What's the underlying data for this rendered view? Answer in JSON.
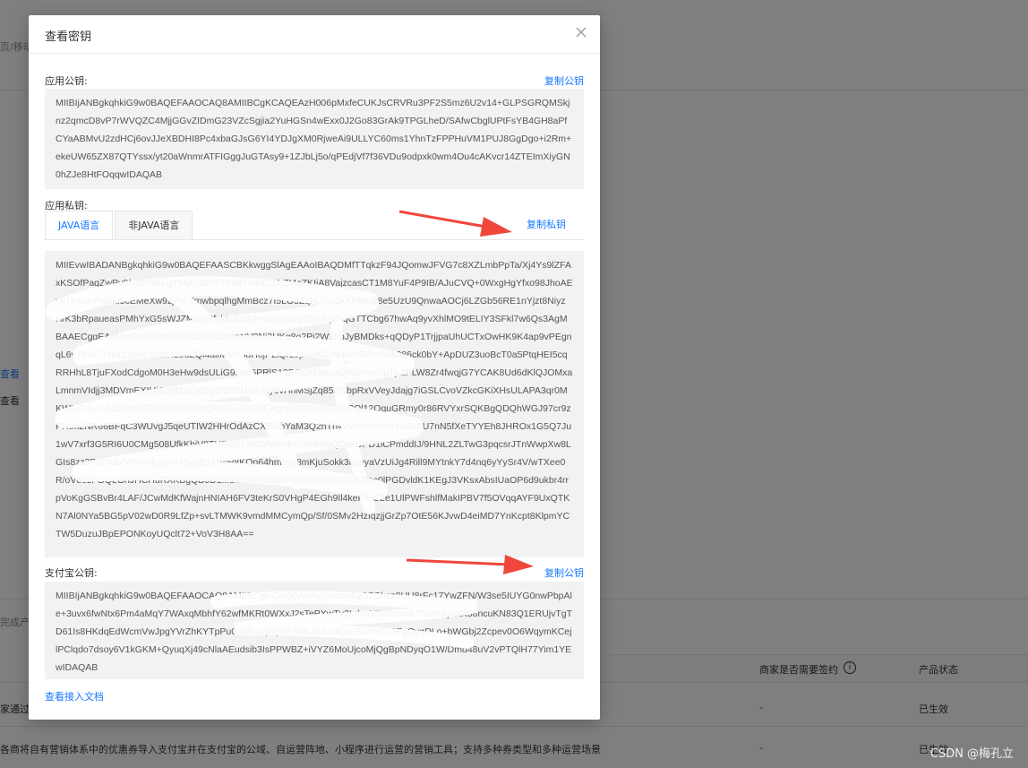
{
  "background": {
    "left_fragments": [
      "页/移动",
      "查看",
      "查看",
      "完成产",
      "家通过"
    ],
    "bottom_row_text": "各商将自有营销体系中的优惠券导入支付宝并在支付宝的公域、自运营阵地、小程序进行运营的营销工具；支持多种券类型和多种运营场景",
    "table_headers": {
      "signing": "商家是否需要签约",
      "status": "产品状态"
    },
    "row1": {
      "signing": "-",
      "status": "已生效"
    },
    "row2": {
      "signing": "-",
      "status": "已生效"
    }
  },
  "modal": {
    "title": "查看密钥",
    "app_public_key": {
      "label": "应用公钥:",
      "copy_label": "复制公钥",
      "value": "MIIBIjANBgkqhkiG9w0BAQEFAAOCAQ8AMIIBCgKCAQEAzH006pMxfeCUKJsCRVRu3PF2S5mz6U2v14+GLPSGRQMSkjnz2qmcD8vP7rWVQZC4MjjGGvZIDmG23VZcSgjia2YuHGSn4wExx0J2Go83GrAk9TPGLheD/SAfwCbglUPtFsYB4GH8aPfCYaABMvU2zdHCj6ovJJeXBDHI8Pc4xbaGJsG6YI4YDJgXM0RjweAi9ULLYC60ms1YhnTzFPPHuVM1PUJ8GgDgo+i2Rm+ekeUW65ZX87QTYssx/yt20aWnmrATFIGggJuGTAsy9+1ZJbLj5o/qPEdjVf7f36VDu9odpxk0wm4Ou4cAKvcr14ZTEImXiyGN0hZJe8HtFOqqwIDAQAB"
    },
    "app_private_key": {
      "label": "应用私钥:",
      "copy_label": "复制私钥",
      "tabs": [
        "JAVA语言",
        "非JAVA语言"
      ],
      "active_tab": 0,
      "value": "MIIEvwIBADANBgkqhkiG9w0BAQEFAASCBKkwggSlAgEAAoIBAQDMfTTqkzF94JQomwJFVG7c8XZLmbPpTa/Xj4Ys9lZFAxKSOfPaqZwPy8/utZVBkLgYMjiEoDcRTbbdVIxKCOJrZI4cZKIjA8VajzcasCT1M8YuF4P9IB/AJuCVQ+0WxgHgYfxo98JhoAEy9TK6cKPqi8kI5cEMeXw9zjFtoYmwbpqlhgMmBcz7I5LG5ZqhLrSa2xXPMU88e5UzU9QnwaAOCj6LZGb56RE1nYjzt8NiyzH/K3bRpaueasPMhYxG5sWJZMaQRfvkIcZaMJ+o8R2N1Q7fpUCj2hqGTTCbg67hwAq9yvXhlMO9tELIY3SFkl7w6Qs3AgMBAAECggEAaHrq5Hybt8pdK3BjJzqbf1azwsNV8Nj2HKq8o2Pi2W1hpJyBMDks+qQDyP1TrjjpaUhUCTxOwHK9K4ap9vPEgnqL6vTIOs7J1HQ10wEz4zn4z9oZQl4alfMM13oHojPLiQrLJpwvKZJNrpeDG2mS9k086ck0bY+ApDUZ3uoBcT0a5PtqHEI5cqRRHhL8TjuFXodCdgoM0H3eHw9dsULiG9Bxc6PRlS13BGOrZNsxaQ/b3+Kw7gTpZPLW8Zr4fwqjG7YCAK8Ud6dKlQJOMxaLmnmVIdjj3MDVmEXIUj4QI910QKBgQD7DM5KrRy0vHnMSjZq85RSbpRxVVeyJdajg7iGSLCvoVZkcGKiXHsULAPA3qr0MKWIuFsa+bZdOMnKED0RvckIJ3ChQfhsEej7/5F0CKgNVyFSJQEIsuvCQl12OquGRmy0r86RVYxrSQKBgQDQhWGJ97cr9zPHtm2NR66BFqC3WUvgJ5qeUTIW2HHrOdAzCXBl3bYaM3Q2nTnyVWIH4+Hzb1wSc6U7nN5fXeTYYEh8JHROx1G5Q7Ju1wV7xrf3G5RI6U0CMg508UfkKbiV0THFKR1q0ZVkk5nPSUwKBgQDxeDPD1iCPmddIJ/9HNL2ZLTwG3pqcsrJTnWwpXw8LGIs8zz3PpzYBxV0AYxkgeRiHTyjNEi37mP8KQp64hmkQt8mKjuSokk3rDpyaVzUiJg4Rill9MYtnkY7d4nq6yYySr4V/wTXee0R/oV88zFGQLGhJHCHuRXKBgQDJD1M1MNMbSBdJPkYBpdWzkGF5kZjoc0lPGDvldK1KEgJ3VKsxAbsIUaOP6d9ukbr4rrpVoKgGSBvBr4LAF/JCwMdKfWajnHNIAH6FV3teKrS0VHgP4EGh9Il4kePiHC2e1UlPWFshlfMakIPBV7f5OVqqAYF9UxQTKN7Al0NYa5BG5pV02wD0R9LfZp+svLTMWK9vmdMMCymQp/Sf/0SMv2HzIqzjjGrZp7OtE56KJvwD4eiMD7YnKcpt8KlpmYCTW5DuzuJBpEPONKoyUQclt72+VoV3H8AA=="
    },
    "alipay_public_key": {
      "label": "支付宝公钥:",
      "copy_label": "复制公钥",
      "value": "MIIBIjANBgkqhkiG9w0BAQEFAAOCAQ8AMIIBCgKCAQEAu0qUt+cozAqG7Gbcz8UU8rFc17YwZFN/W3se5IUYG0nwPbpAle+3uvx6fwNtx6Pm4aMqY7WAxqMbhfY62wfMKRt0WXxJ2sTePXwTv2LdxaY5XBI5mK7bbXDrj4XX58ncuKN83Q1ERUjvTgTD61Is8HKdqEdWcmVwJpgYVrZhKYTpPu03eRaVpVjVPJM5J6JGOQcuSIW9GL3FgQyqDLo+bWGbj2Zcpev0O6WqymKCejlPClqdo7dsoy6V1kGKM+QyuqXj49cNlaAEudsib3IsPPWBZ+iVYZ6MoUjcoMjQgBpNDyqO1W/Dmd48uV2vPTQlH77Yim1YEwIDAQAB"
    },
    "doc_link": "查看接入文档"
  },
  "watermark": "CSDN @梅孔立",
  "colors": {
    "accent": "#1677ff",
    "arrow": "#f0473a",
    "key_bg": "#f2f2f2"
  }
}
